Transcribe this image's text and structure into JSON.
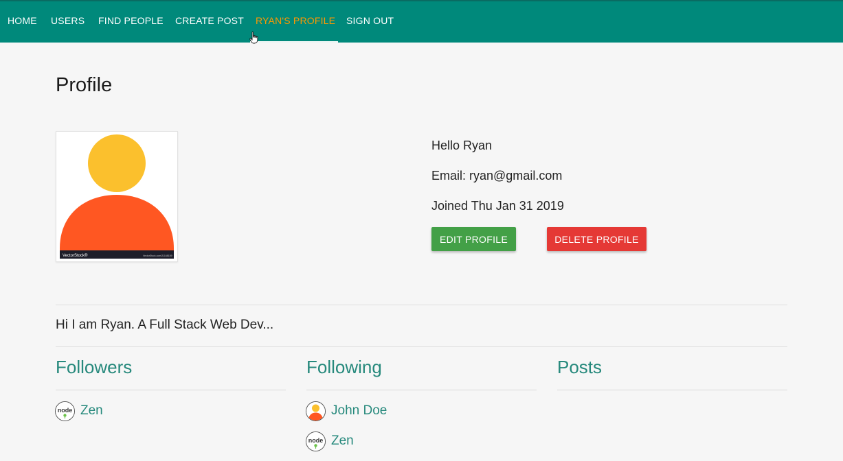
{
  "nav": {
    "items": [
      {
        "label": "HOME",
        "active": false
      },
      {
        "label": "USERS",
        "active": false
      },
      {
        "label": "FIND PEOPLE",
        "active": false
      },
      {
        "label": "CREATE POST",
        "active": false
      },
      {
        "label": "RYAN'S PROFILE",
        "active": true
      },
      {
        "label": "SIGN OUT",
        "active": false
      }
    ]
  },
  "colors": {
    "navbar": "#00897b",
    "active_nav": "#ff9800",
    "accent_text": "#26897c",
    "edit_button": "#43a047",
    "delete_button": "#e53935",
    "avatar_head": "#fbc02d",
    "avatar_body": "#ff5722"
  },
  "profile": {
    "title": "Profile",
    "avatar_watermark_left": "VectorStock®",
    "avatar_watermark_right": "VectorStock.com/21168159",
    "greeting": "Hello Ryan",
    "email": "Email: ryan@gmail.com",
    "joined": "Joined Thu Jan 31 2019",
    "edit_label": "EDIT PROFILE",
    "delete_label": "DELETE PROFILE",
    "about": "Hi I am Ryan. A Full Stack Web Dev..."
  },
  "followers": {
    "heading": "Followers",
    "people": [
      {
        "name": "Zen",
        "avatar": "node-logo-icon"
      }
    ]
  },
  "following": {
    "heading": "Following",
    "people": [
      {
        "name": "John Doe",
        "avatar": "default-user-icon"
      },
      {
        "name": "Zen",
        "avatar": "node-logo-icon"
      }
    ]
  },
  "posts": {
    "heading": "Posts"
  }
}
